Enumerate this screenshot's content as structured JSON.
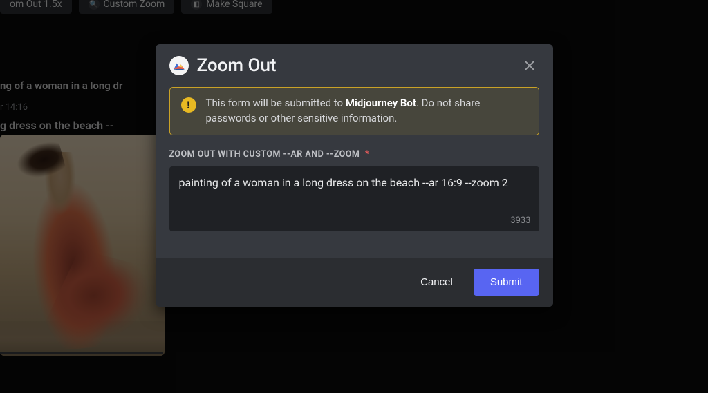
{
  "background": {
    "buttons": [
      {
        "label": "om Out 1.5x"
      },
      {
        "label": "Custom Zoom"
      },
      {
        "label": "Make Square"
      }
    ],
    "message_line1": "ng of a woman in a long dr",
    "timestamp_partial": "r 14:16",
    "message_line2": "g dress on the beach --"
  },
  "modal": {
    "title": "Zoom Out",
    "warning_prefix": "This form will be submitted to ",
    "warning_bot": "Midjourney Bot",
    "warning_suffix": ". Do not share passwords or other sensitive information.",
    "field_label": "ZOOM OUT WITH CUSTOM --AR AND --ZOOM",
    "required_marker": "*",
    "textarea_value": "painting of a woman in a long dress on the beach --ar 16:9 --zoom 2",
    "char_count": "3933",
    "cancel_label": "Cancel",
    "submit_label": "Submit"
  }
}
